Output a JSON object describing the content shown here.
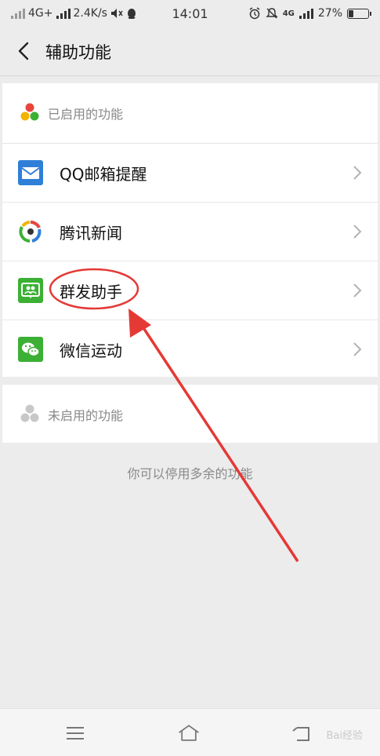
{
  "status_bar": {
    "network": "4G+",
    "speed": "2.4K/s",
    "time": "14:01",
    "network_right": "4G",
    "battery_percent": "27%",
    "battery_level": 0.27
  },
  "header": {
    "title": "辅助功能"
  },
  "enabled_section": {
    "label": "已启用的功能",
    "items": [
      {
        "label": "QQ邮箱提醒",
        "icon": "mail-icon"
      },
      {
        "label": "腾讯新闻",
        "icon": "tencent-news-icon"
      },
      {
        "label": "群发助手",
        "icon": "group-message-icon"
      },
      {
        "label": "微信运动",
        "icon": "wechat-sport-icon"
      }
    ]
  },
  "disabled_section": {
    "label": "未启用的功能"
  },
  "hint_text": "你可以停用多余的功能",
  "navigation": {
    "menu": "menu-icon",
    "home": "home-icon",
    "back": "back-nav-icon"
  },
  "watermark": "Bai经验",
  "colors": {
    "annotation_red": "#e53935",
    "accent_blue": "#2f7fd8",
    "wechat_green": "#3cb034"
  }
}
